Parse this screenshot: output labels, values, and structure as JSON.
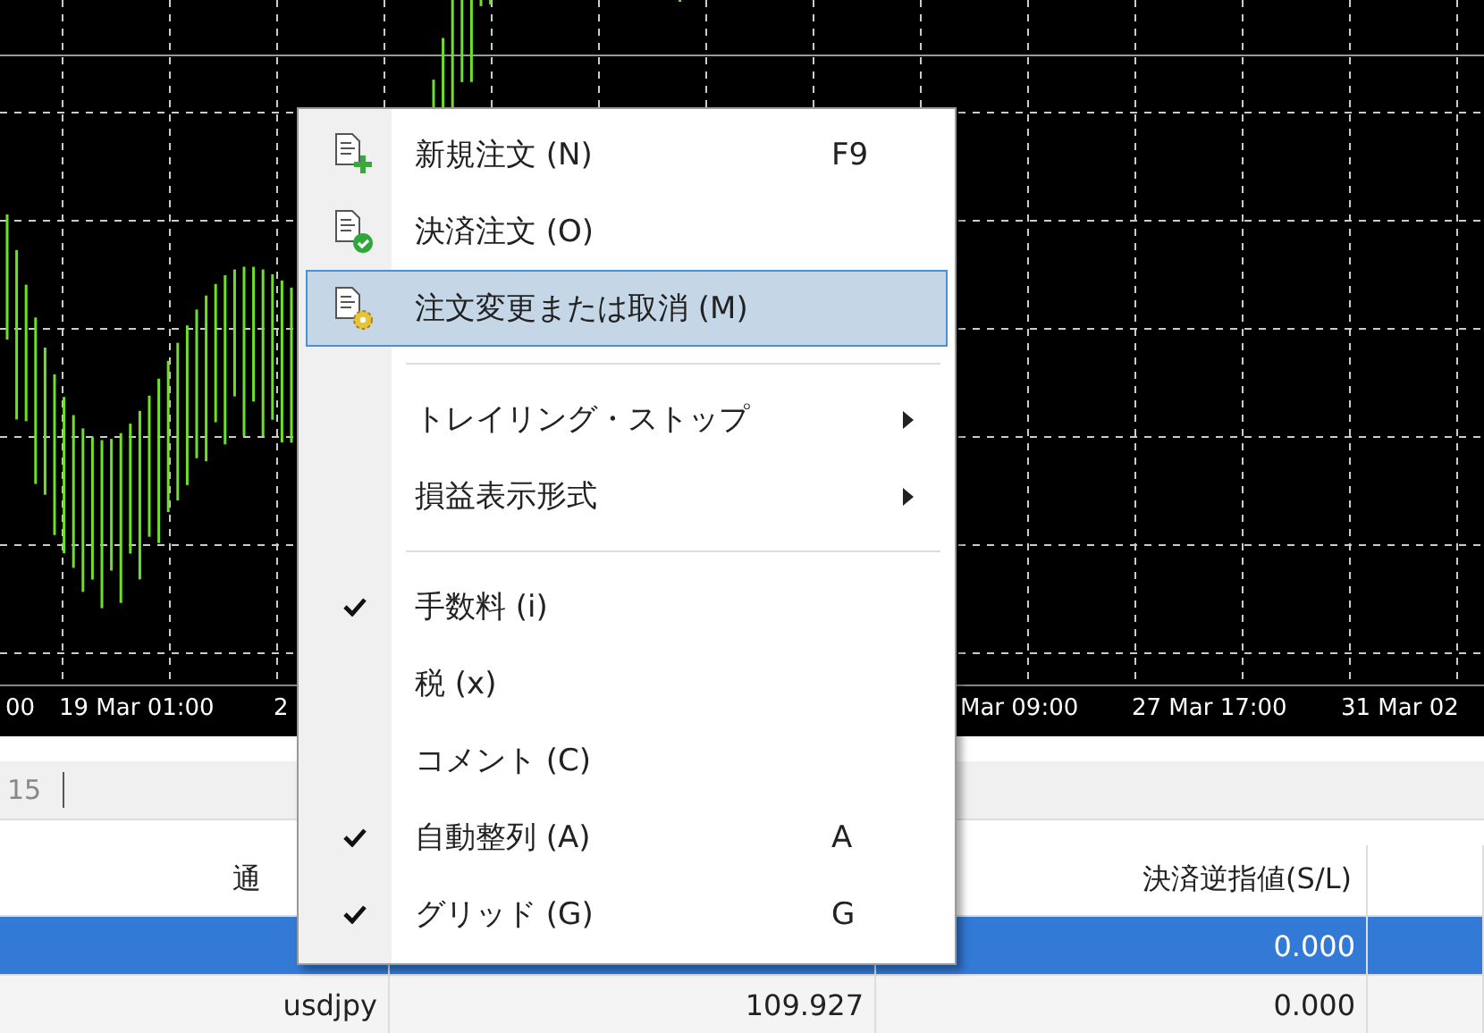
{
  "chart": {
    "axis_labels": [
      "00",
      "19 Mar 01:00",
      "2",
      "Mar 09:00",
      "27 Mar 17:00",
      "31 Mar 02"
    ]
  },
  "tab_strip": {
    "label": "15"
  },
  "table": {
    "columns": [
      "通",
      "",
      "決済逆指値(S/L)",
      ""
    ],
    "rows": [
      {
        "selected": true,
        "cells": [
          "",
          "",
          "0.000",
          ""
        ]
      },
      {
        "selected": false,
        "cells": [
          "usdjpy",
          "109.927",
          "0.000",
          ""
        ]
      }
    ]
  },
  "context_menu": {
    "items": [
      {
        "kind": "item",
        "label": "新規注文 (N)",
        "shortcut": "F9",
        "checked": false,
        "submenu": false,
        "selected": false
      },
      {
        "kind": "item",
        "label": "決済注文 (O)",
        "checked": false,
        "submenu": false,
        "selected": false
      },
      {
        "kind": "item",
        "label": "注文変更または取消 (M)",
        "checked": false,
        "submenu": false,
        "selected": true
      },
      {
        "kind": "separator"
      },
      {
        "kind": "item",
        "label": "トレイリング・ストップ",
        "checked": false,
        "submenu": true,
        "selected": false
      },
      {
        "kind": "item",
        "label": "損益表示形式",
        "checked": false,
        "submenu": true,
        "selected": false
      },
      {
        "kind": "separator"
      },
      {
        "kind": "item",
        "label": "手数料 (i)",
        "checked": true,
        "submenu": false,
        "selected": false
      },
      {
        "kind": "item",
        "label": "税 (x)",
        "checked": false,
        "submenu": false,
        "selected": false
      },
      {
        "kind": "item",
        "label": "コメント (C)",
        "checked": false,
        "submenu": false,
        "selected": false
      },
      {
        "kind": "item",
        "label": "自動整列 (A)",
        "shortcut": "A",
        "checked": true,
        "submenu": false,
        "selected": false
      },
      {
        "kind": "item",
        "label": "グリッド (G)",
        "shortcut": "G",
        "checked": true,
        "submenu": false,
        "selected": false
      }
    ]
  }
}
